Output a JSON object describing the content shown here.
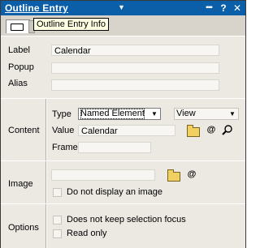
{
  "window": {
    "title": "Outline Entry",
    "title_arrow": "▼",
    "dots": "▪▪▪",
    "help": "?",
    "close": "✕"
  },
  "tooltip": "Outline Entry Info",
  "basics": {
    "label_label": "Label",
    "label_value": "Calendar",
    "popup_label": "Popup",
    "popup_value": "",
    "alias_label": "Alias",
    "alias_value": ""
  },
  "content": {
    "section_label": "Content",
    "type_label": "Type",
    "type_value": "Named Element",
    "view_value": "View",
    "value_label": "Value",
    "value_value": "Calendar",
    "frame_label": "Frame",
    "frame_value": "",
    "at_symbol": "@"
  },
  "image": {
    "section_label": "Image",
    "field_value": "",
    "at_symbol": "@",
    "no_display_label": "Do not display an image",
    "no_display_checked": false
  },
  "options": {
    "section_label": "Options",
    "keep_focus_label": "Does not keep selection focus",
    "keep_focus_checked": false,
    "read_only_label": "Read only",
    "read_only_checked": false
  },
  "colors": {
    "titlebar": "#0a5fa8",
    "panel": "#ece9e3",
    "tooltip_bg": "#ffffe1"
  }
}
